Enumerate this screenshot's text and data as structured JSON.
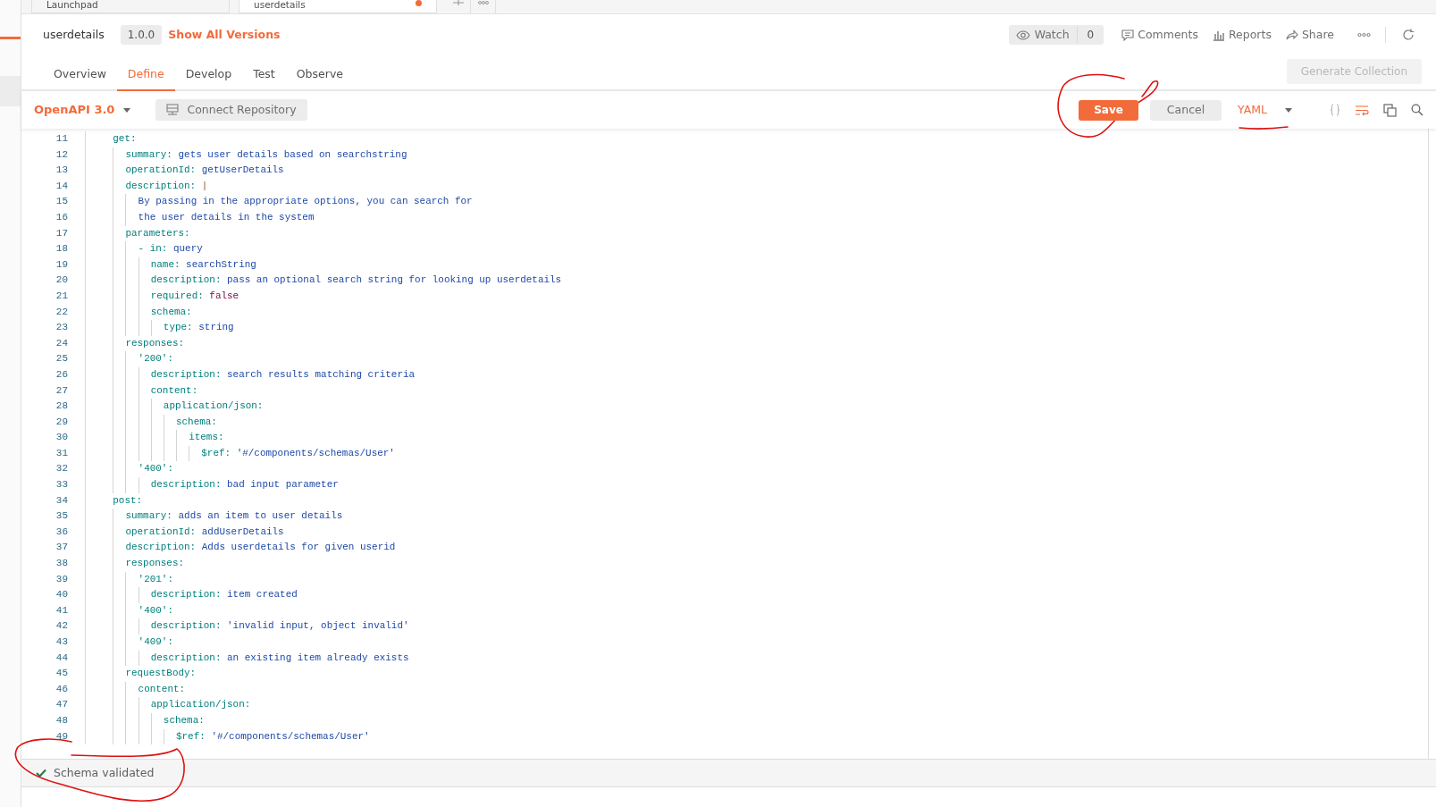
{
  "open_tabs": [
    {
      "label": "Launchpad",
      "selected": false,
      "unsaved": false
    },
    {
      "label": "userdetails",
      "selected": true,
      "unsaved": true
    }
  ],
  "api": {
    "name": "userdetails",
    "version": "1.0.0",
    "versions_link": "Show All Versions"
  },
  "actions": {
    "watch": {
      "label": "Watch",
      "count": "0"
    },
    "comments": "Comments",
    "reports": "Reports",
    "share": "Share"
  },
  "nav_tabs": [
    {
      "label": "Overview",
      "selected": false
    },
    {
      "label": "Define",
      "selected": true
    },
    {
      "label": "Develop",
      "selected": false
    },
    {
      "label": "Test",
      "selected": false
    },
    {
      "label": "Observe",
      "selected": false
    }
  ],
  "generate_collection": {
    "label": "Generate Collection",
    "disabled": true
  },
  "toolbar": {
    "spec_format": "OpenAPI 3.0",
    "connect": "Connect Repository",
    "save": "Save",
    "cancel": "Cancel",
    "language": "YAML",
    "word_wrap": true
  },
  "editor_lines": [
    {
      "number": "11",
      "key": "    get:"
    },
    {
      "number": "12",
      "key": "      summary:",
      "value": "gets user details based on searchstring",
      "kind": "string"
    },
    {
      "number": "13",
      "key": "      operationId:",
      "value": "getUserDetails",
      "kind": "string"
    },
    {
      "number": "14",
      "key": "      description:",
      "value": "|",
      "kind": "block"
    },
    {
      "number": "15",
      "value": "        By passing in the appropriate options, you can search for",
      "kind": "string"
    },
    {
      "number": "16",
      "value": "        the user details in the system",
      "kind": "string"
    },
    {
      "number": "17",
      "key": "      parameters:"
    },
    {
      "number": "18",
      "key": "        - in:",
      "value": "query",
      "kind": "string"
    },
    {
      "number": "19",
      "key": "          name:",
      "value": "searchString",
      "kind": "string"
    },
    {
      "number": "20",
      "key": "          description:",
      "value": "pass an optional search string for looking up userdetails",
      "kind": "string"
    },
    {
      "number": "21",
      "key": "          required:",
      "value": "false",
      "kind": "keyword"
    },
    {
      "number": "22",
      "key": "          schema:"
    },
    {
      "number": "23",
      "key": "            type:",
      "value": "string",
      "kind": "string"
    },
    {
      "number": "24",
      "key": "      responses:"
    },
    {
      "number": "25",
      "key": "        '200':"
    },
    {
      "number": "26",
      "key": "          description:",
      "value": "search results matching criteria",
      "kind": "string"
    },
    {
      "number": "27",
      "key": "          content:"
    },
    {
      "number": "28",
      "key": "            application/json:"
    },
    {
      "number": "29",
      "key": "              schema:"
    },
    {
      "number": "30",
      "key": "                items:"
    },
    {
      "number": "31",
      "key": "                  $ref:",
      "value": "'#/components/schemas/User'",
      "kind": "string"
    },
    {
      "number": "32",
      "key": "        '400':"
    },
    {
      "number": "33",
      "key": "          description:",
      "value": "bad input parameter",
      "kind": "string"
    },
    {
      "number": "34",
      "key": "    post:"
    },
    {
      "number": "35",
      "key": "      summary:",
      "value": "adds an item to user details",
      "kind": "string"
    },
    {
      "number": "36",
      "key": "      operationId:",
      "value": "addUserDetails",
      "kind": "string"
    },
    {
      "number": "37",
      "key": "      description:",
      "value": "Adds userdetails for given userid",
      "kind": "string"
    },
    {
      "number": "38",
      "key": "      responses:"
    },
    {
      "number": "39",
      "key": "        '201':"
    },
    {
      "number": "40",
      "key": "          description:",
      "value": "item created",
      "kind": "string"
    },
    {
      "number": "41",
      "key": "        '400':"
    },
    {
      "number": "42",
      "key": "          description:",
      "value": "'invalid input, object invalid'",
      "kind": "string"
    },
    {
      "number": "43",
      "key": "        '409':"
    },
    {
      "number": "44",
      "key": "          description:",
      "value": "an existing item already exists",
      "kind": "string"
    },
    {
      "number": "45",
      "key": "      requestBody:"
    },
    {
      "number": "46",
      "key": "        content:"
    },
    {
      "number": "47",
      "key": "          application/json:"
    },
    {
      "number": "48",
      "key": "            schema:"
    },
    {
      "number": "49",
      "key": "              $ref:",
      "value": "'#/components/schemas/User'",
      "kind": "string"
    }
  ],
  "status": {
    "text": "Schema validated",
    "valid": true
  }
}
